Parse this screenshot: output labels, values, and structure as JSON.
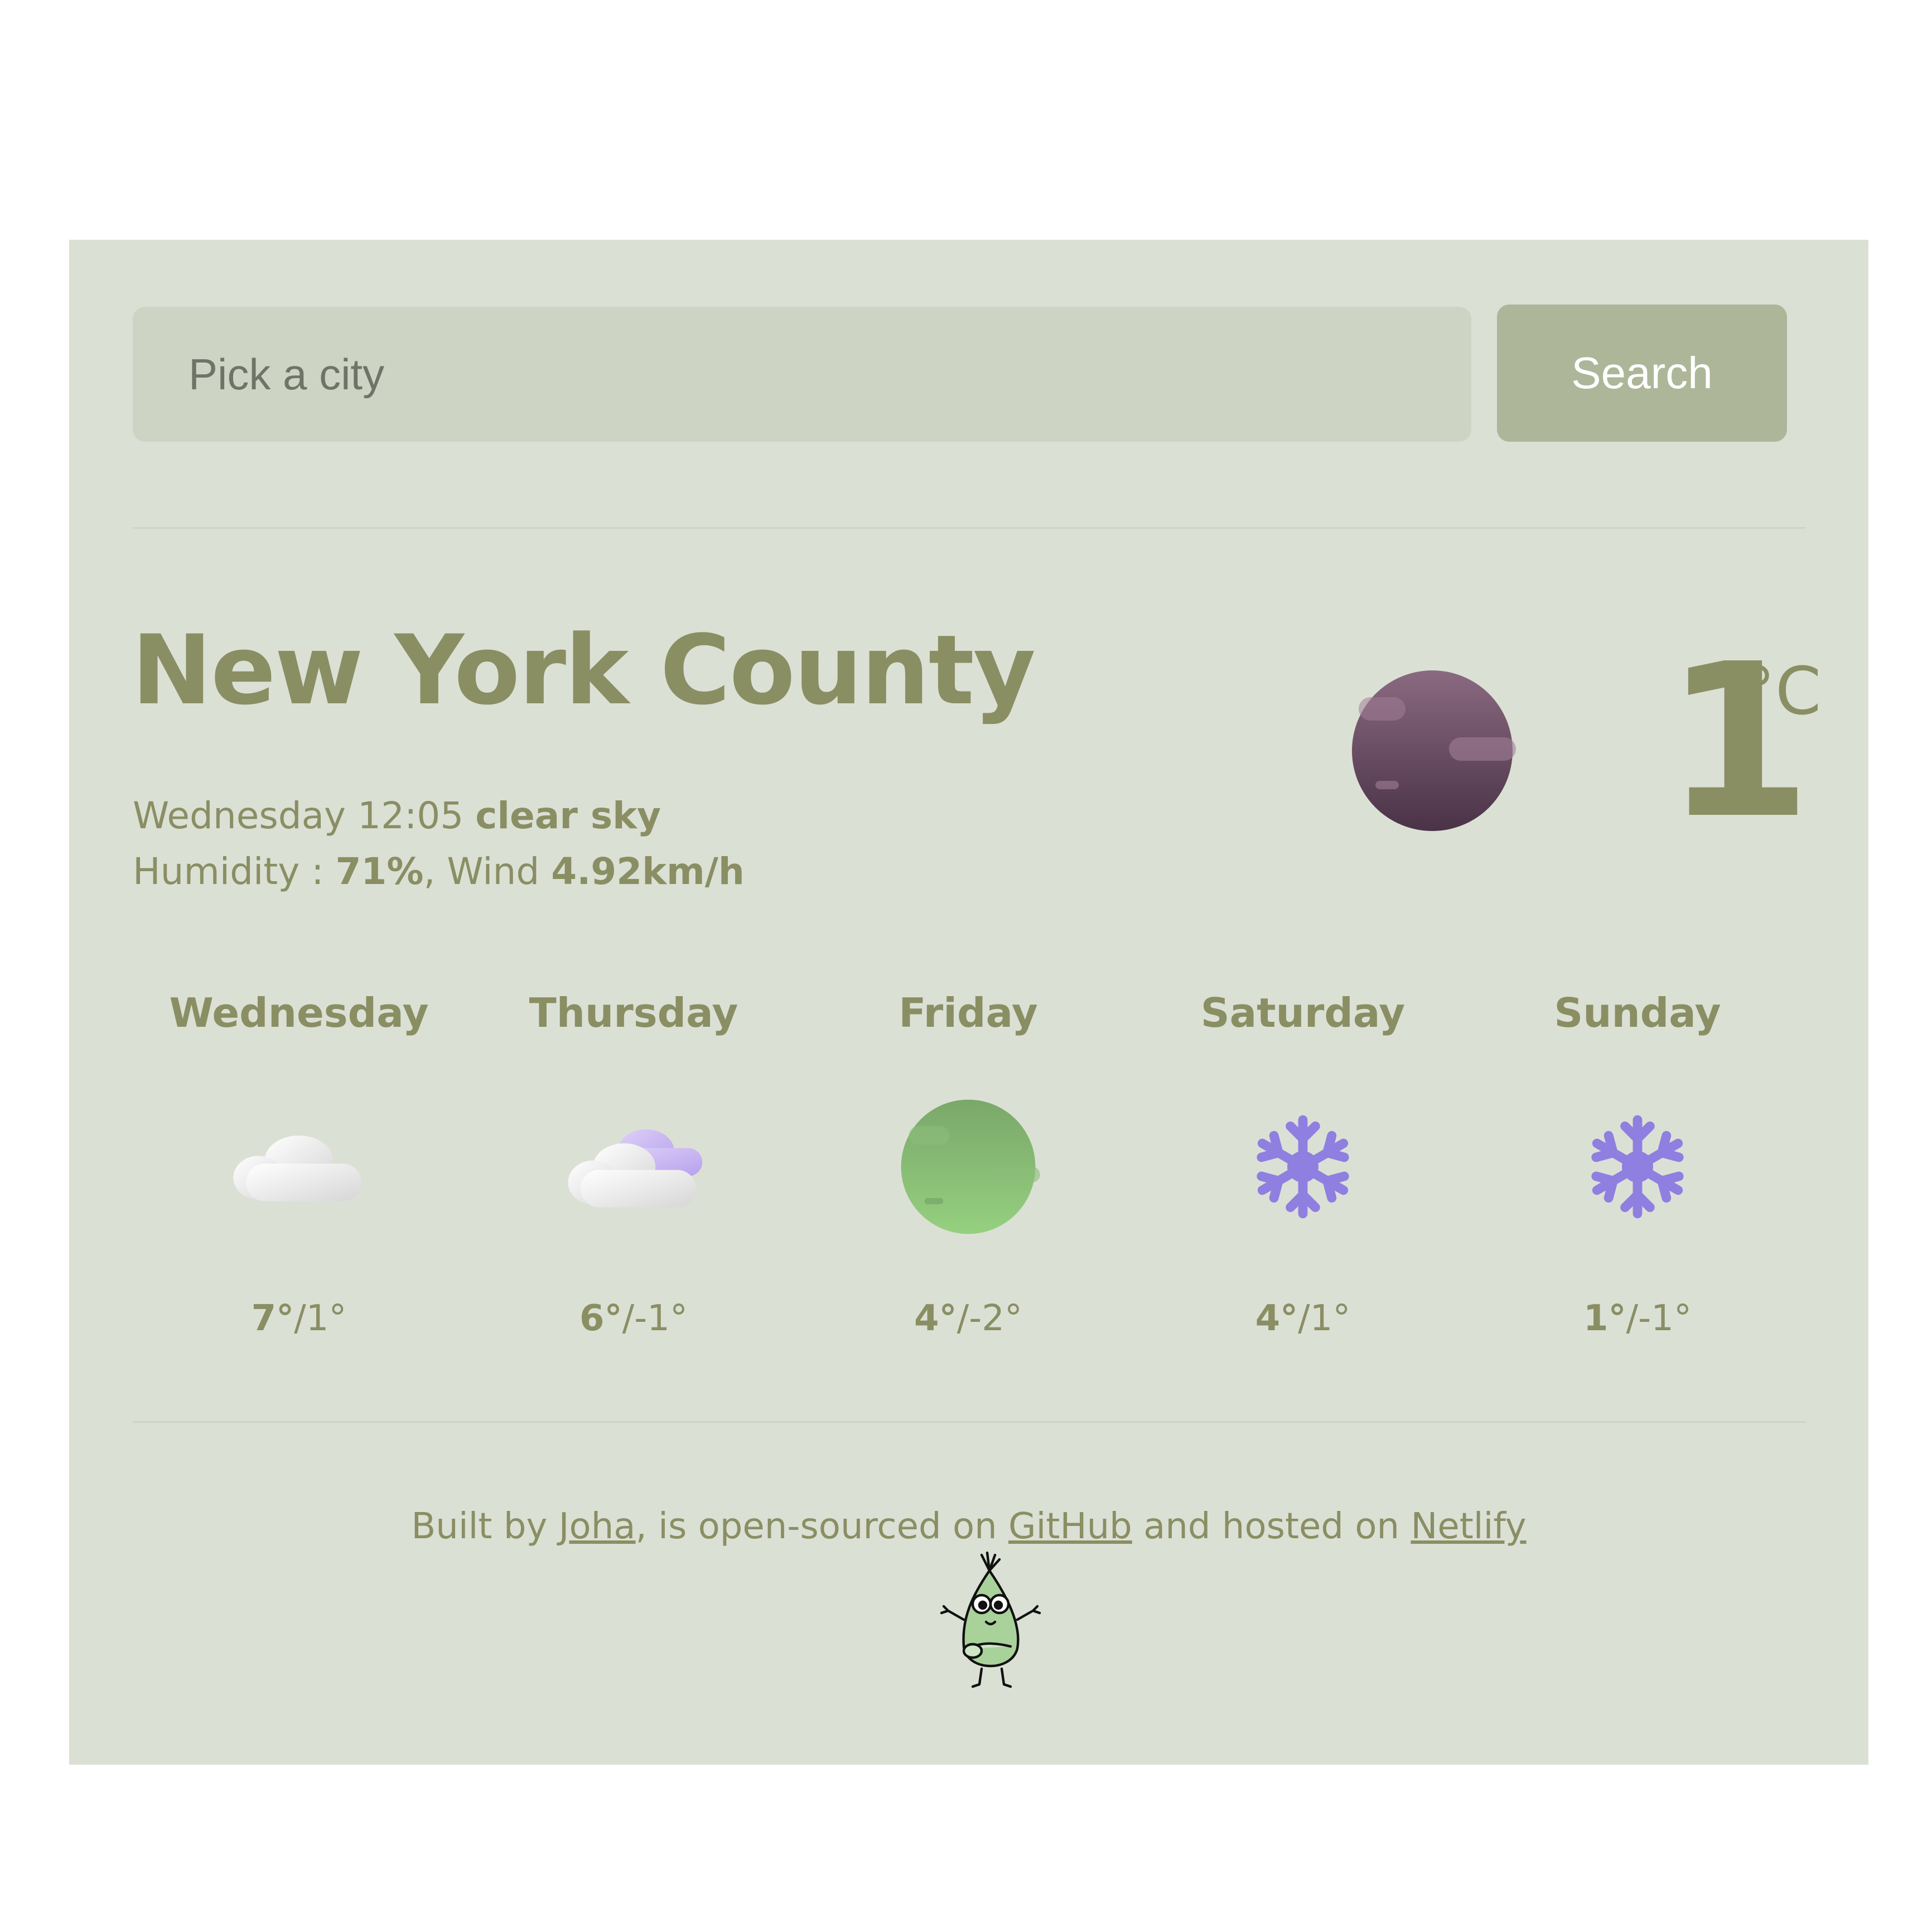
{
  "search": {
    "placeholder": "Pick a city",
    "button_label": "Search"
  },
  "current": {
    "city": "New York County",
    "day_time": "Wednesday 12:05",
    "description": "clear sky",
    "humidity_label": "Humidity :",
    "humidity_value": "71%",
    "wind_label": ", Wind",
    "wind_value": "4.92km/h",
    "temperature": "1",
    "unit": "°C",
    "icon": "moon-icon"
  },
  "forecast": [
    {
      "day": "Wednesday",
      "icon": "cloud-icon",
      "max": "7°",
      "min": "/1°"
    },
    {
      "day": "Thursday",
      "icon": "cloud-icon",
      "max": "6°",
      "min": "/-1°"
    },
    {
      "day": "Friday",
      "icon": "moon-icon",
      "max": "4°",
      "min": "/-2°"
    },
    {
      "day": "Saturday",
      "icon": "snowflake-icon",
      "max": "4°",
      "min": "/1°"
    },
    {
      "day": "Sunday",
      "icon": "snowflake-icon",
      "max": "1°",
      "min": "/-1°"
    }
  ],
  "footer": {
    "text_1": "Built by ",
    "author_link": "Joha",
    "text_2": ", is open-sourced on ",
    "github_link": "GitHub",
    "text_3": " and hosted on ",
    "netlify_link": "Netlify"
  },
  "colors": {
    "card_background": "#dbe0d5",
    "accent_text": "#8a8e63",
    "button": "#adb699",
    "snow": "#8f7fe0"
  }
}
